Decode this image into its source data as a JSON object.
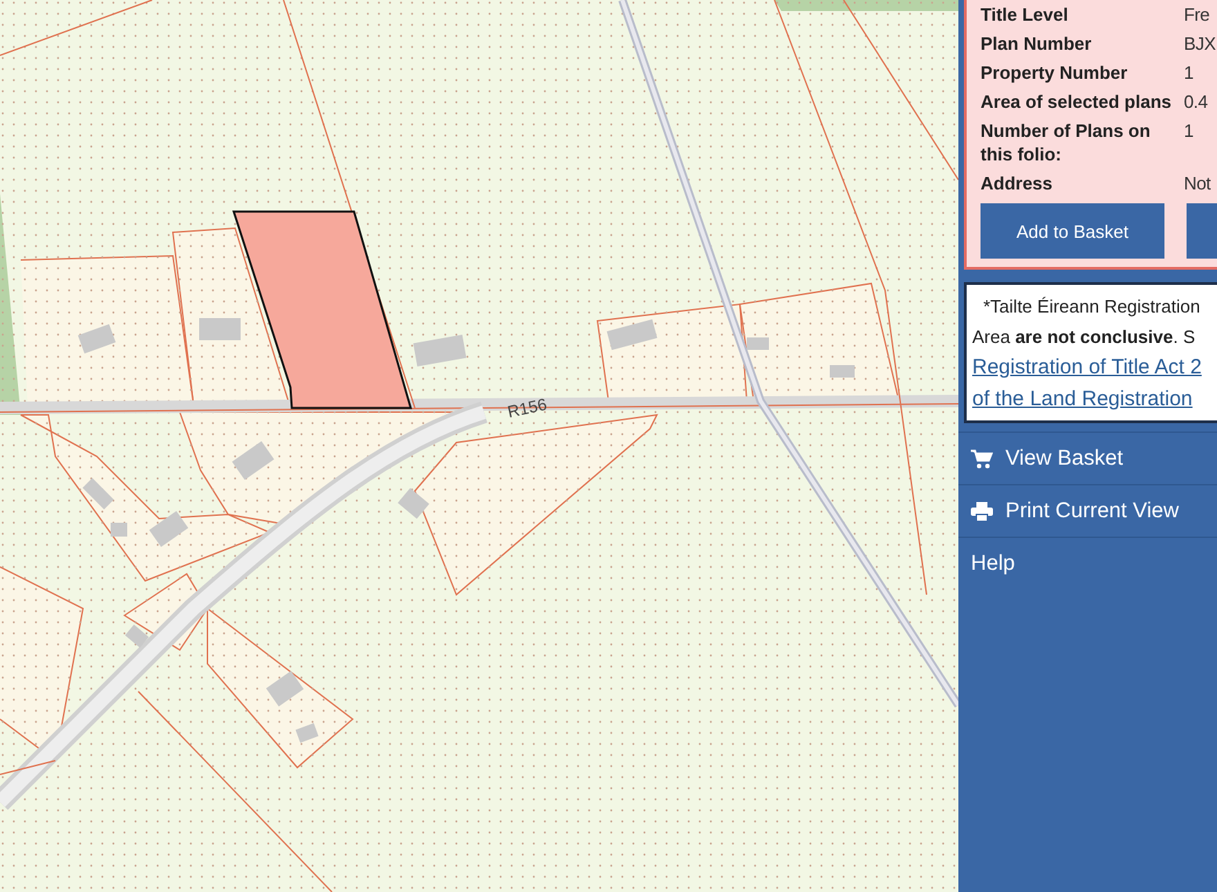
{
  "map": {
    "road_label": "R156"
  },
  "property_details": {
    "rows": [
      {
        "label": "Title Level",
        "value": "Fre"
      },
      {
        "label": "Plan Number",
        "value": "BJX"
      },
      {
        "label": "Property Number",
        "value": "1"
      },
      {
        "label": "Area of selected plans",
        "value": "0.4"
      },
      {
        "label": "Number of Plans on this folio:",
        "value": "1"
      },
      {
        "label": "Address",
        "value": "Not"
      }
    ],
    "buttons": [
      "Add to Basket"
    ]
  },
  "notice": {
    "lines": [
      "*Tailte Éireann Registration",
      "Area **are not conclusive**. S"
    ],
    "links": [
      "Registration of Title Act 2",
      "of the Land Registration"
    ]
  },
  "menu": [
    {
      "kind": "basket",
      "label": "View Basket"
    },
    {
      "kind": "print",
      "label": "Print Current View"
    },
    {
      "kind": "plain",
      "label": "Help"
    }
  ]
}
